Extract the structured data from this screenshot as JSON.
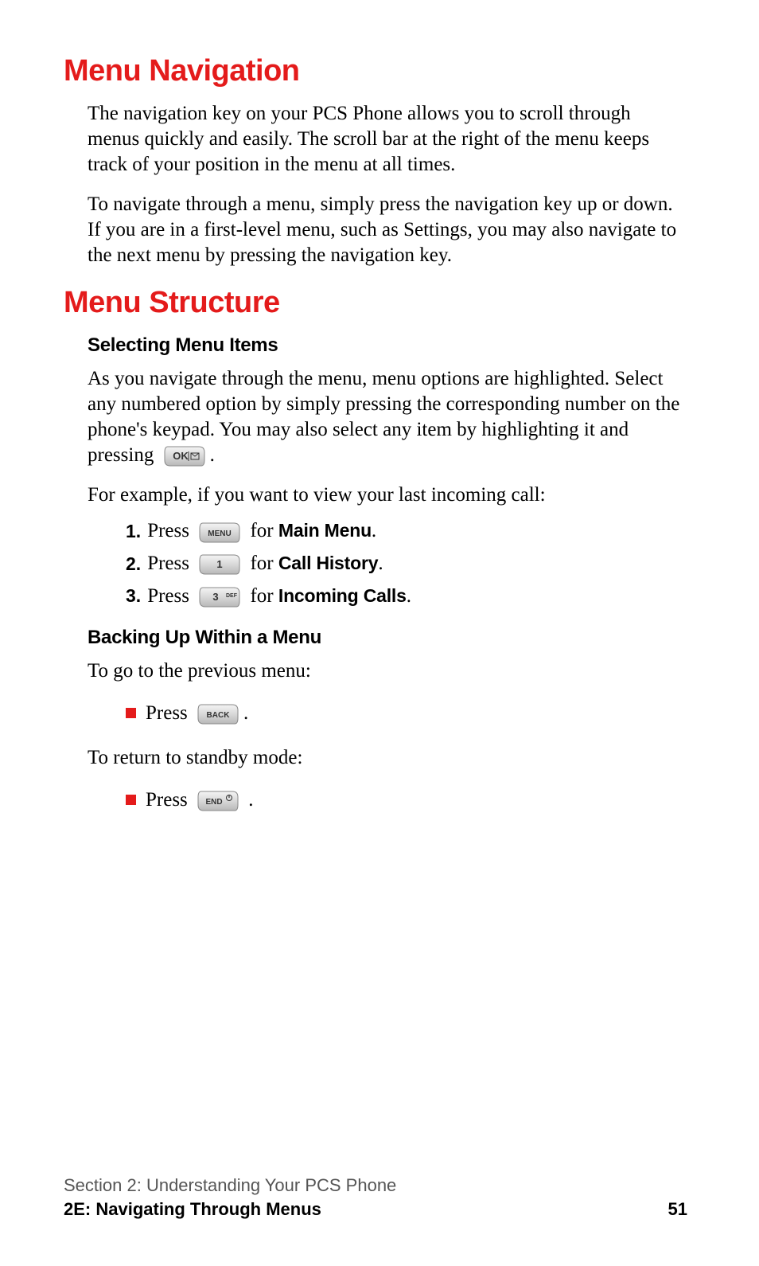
{
  "h1a": "Menu Navigation",
  "p1": "The navigation key on your PCS Phone allows you to scroll through menus quickly and easily. The scroll bar at the right of the menu keeps track of your position in the menu at all times.",
  "p2": "To navigate through a menu, simply press the navigation key up or down. If you are in a first-level menu, such as Settings, you may also navigate to the next menu by pressing the navigation key.",
  "h1b": "Menu Structure",
  "h2a": "Selecting Menu Items",
  "p3a": "As you navigate through the menu, menu options are highlighted. Select any numbered option by simply pressing the corresponding number on the phone's keypad. You may also select any item by highlighting it and pressing ",
  "p3b": ".",
  "p4": "For example, if you want to view your last incoming call:",
  "ol": [
    {
      "n": "1.",
      "pre": " Press ",
      "key": "MENU",
      "mid": " for ",
      "bold": "Main Menu",
      "post": "."
    },
    {
      "n": "2.",
      "pre": " Press ",
      "key": "1",
      "mid": " for ",
      "bold": "Call History",
      "post": "."
    },
    {
      "n": "3.",
      "pre": " Press ",
      "key": "3DEF",
      "mid": " for ",
      "bold": "Incoming Calls",
      "post": "."
    }
  ],
  "h2b": "Backing Up Within a Menu",
  "p5": "To go to the previous menu:",
  "ul1": {
    "pre": "Press ",
    "key": "BACK",
    "post": "."
  },
  "p6": "To return to standby mode:",
  "ul2": {
    "pre": "Press ",
    "key": "END",
    "post": " ."
  },
  "footer": {
    "line1": "Section 2: Understanding Your PCS Phone",
    "line2": "2E: Navigating Through Menus",
    "page": "51"
  },
  "keys": {
    "OK": {
      "label": "OK",
      "mail": true
    },
    "MENU": {
      "label": "MENU"
    },
    "1": {
      "label": "1"
    },
    "3DEF": {
      "label": "3",
      "sup": "DEF"
    },
    "BACK": {
      "label": "BACK"
    },
    "END": {
      "label": "END",
      "power": true
    }
  }
}
